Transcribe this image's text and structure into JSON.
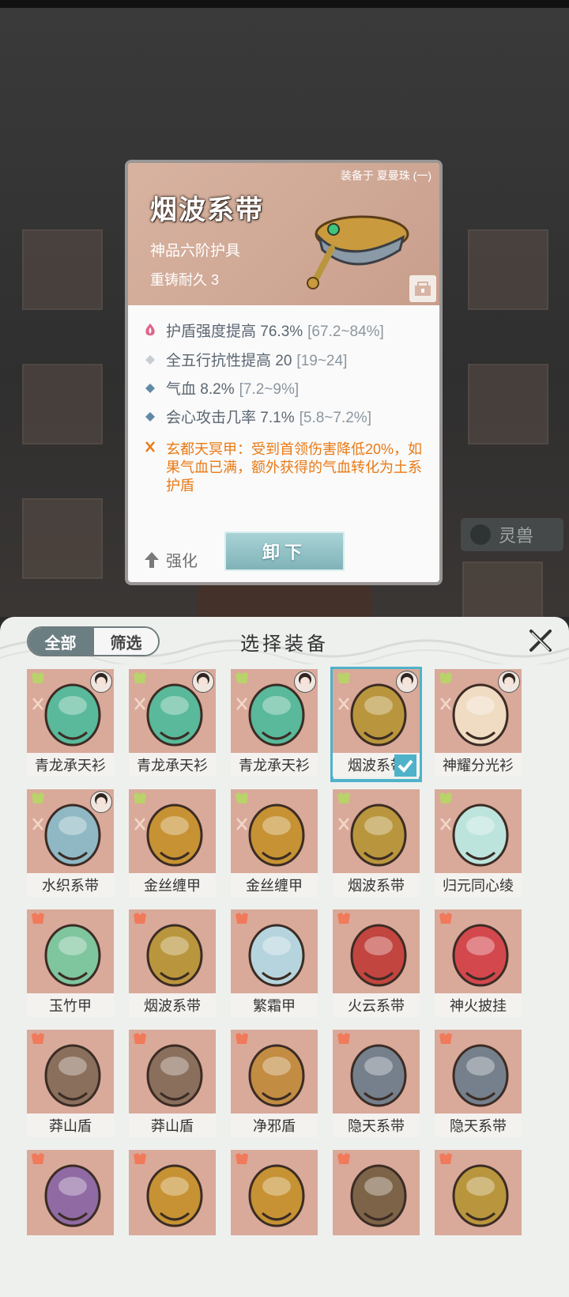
{
  "popup": {
    "equipped_by": "装备于 夏曼珠 (一)",
    "item_name": "烟波系带",
    "grade": "神品六阶护具",
    "durability": "重铸耐久 3",
    "attributes": [
      {
        "icon": "lotus-flame-icon",
        "label": "护盾强度提高 76.3%",
        "range": "[67.2~84%]"
      },
      {
        "icon": "diamond-hollow-icon",
        "label": "全五行抗性提高 20",
        "range": "[19~24]"
      },
      {
        "icon": "diamond-filled-icon",
        "label": "气血 8.2%",
        "range": "[7.2~9%]"
      },
      {
        "icon": "diamond-filled-icon",
        "label": "会心攻击几率 7.1%",
        "range": "[5.8~7.2%]"
      }
    ],
    "special": {
      "icon": "set-bonus-icon",
      "text": "玄都天冥甲：受到首领伤害降低20%，如果气血已满，额外获得的气血转化为土系护盾"
    },
    "enhance_label": "强化",
    "unload_label": "卸下"
  },
  "background": {
    "pet_tab_label": "灵兽"
  },
  "panel": {
    "title": "选择装备",
    "filter_all": "全部",
    "filter_screen": "筛选"
  },
  "items": [
    {
      "name": "青龙承天衫",
      "color": "#59b99a",
      "avatar": true,
      "selected": false
    },
    {
      "name": "青龙承天衫",
      "color": "#59b99a",
      "avatar": true,
      "selected": false
    },
    {
      "name": "青龙承天衫",
      "color": "#59b99a",
      "avatar": true,
      "selected": false
    },
    {
      "name": "烟波系带",
      "color": "#b9963d",
      "avatar": true,
      "selected": true
    },
    {
      "name": "神耀分光衫",
      "color": "#f0dcc3",
      "avatar": true,
      "selected": false
    },
    {
      "name": "水织系带",
      "color": "#8fb8c4",
      "avatar": true,
      "selected": false
    },
    {
      "name": "金丝缠甲",
      "color": "#c69233",
      "avatar": false,
      "selected": false
    },
    {
      "name": "金丝缠甲",
      "color": "#c69233",
      "avatar": false,
      "selected": false
    },
    {
      "name": "烟波系带",
      "color": "#b9963d",
      "avatar": false,
      "selected": false
    },
    {
      "name": "归元同心绫",
      "color": "#bde4dc",
      "avatar": false,
      "selected": false
    },
    {
      "name": "玉竹甲",
      "color": "#7fc59e",
      "avatar": false,
      "selected": false
    },
    {
      "name": "烟波系带",
      "color": "#b9963d",
      "avatar": false,
      "selected": false
    },
    {
      "name": "繁霜甲",
      "color": "#b6d4dd",
      "avatar": false,
      "selected": false
    },
    {
      "name": "火云系带",
      "color": "#c2453f",
      "avatar": false,
      "selected": false
    },
    {
      "name": "神火披挂",
      "color": "#d3484d",
      "avatar": false,
      "selected": false
    },
    {
      "name": "莽山盾",
      "color": "#8a6f5c",
      "avatar": false,
      "selected": false
    },
    {
      "name": "莽山盾",
      "color": "#8a6f5c",
      "avatar": false,
      "selected": false
    },
    {
      "name": "净邪盾",
      "color": "#c28c43",
      "avatar": false,
      "selected": false
    },
    {
      "name": "隐天系带",
      "color": "#75808c",
      "avatar": false,
      "selected": false
    },
    {
      "name": "隐天系带",
      "color": "#75808c",
      "avatar": false,
      "selected": false
    },
    {
      "name": "",
      "color": "#8f6aa3",
      "avatar": false,
      "selected": false
    },
    {
      "name": "",
      "color": "#c69233",
      "avatar": false,
      "selected": false
    },
    {
      "name": "",
      "color": "#c69233",
      "avatar": false,
      "selected": false
    },
    {
      "name": "",
      "color": "#7d6448",
      "avatar": false,
      "selected": false
    },
    {
      "name": "",
      "color": "#b9963d",
      "avatar": false,
      "selected": false
    }
  ]
}
